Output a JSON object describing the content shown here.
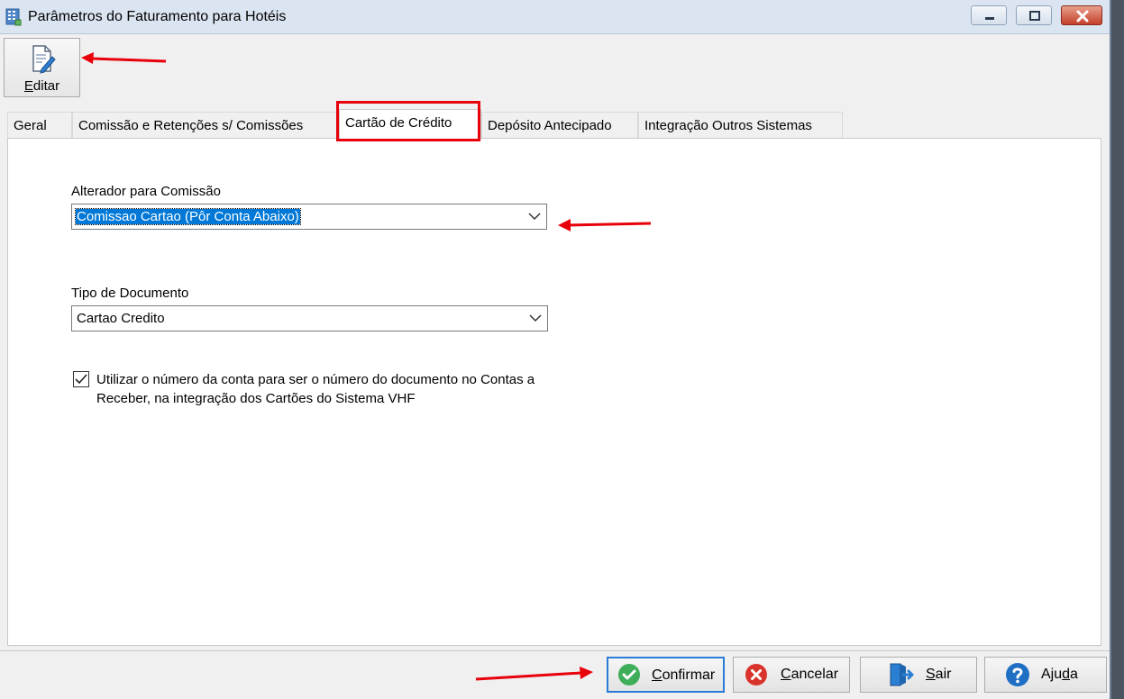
{
  "window": {
    "title": "Parâmetros do Faturamento para Hotéis"
  },
  "toolbar": {
    "edit_label": "Editar",
    "edit_accel": "E",
    "edit_rest": "ditar"
  },
  "tabs": [
    {
      "label": "Geral"
    },
    {
      "label": "Comissão e Retenções s/ Comissões"
    },
    {
      "label": "Cartão de Crédito",
      "active": true
    },
    {
      "label": "Depósito Antecipado"
    },
    {
      "label": "Integração Outros Sistemas"
    }
  ],
  "form": {
    "alterador_label": "Alterador para Comissão",
    "alterador_value": "Comissao Cartao (Pôr Conta Abaixo)",
    "tipo_label": "Tipo de Documento",
    "tipo_value": "Cartao Credito",
    "checkbox_checked": true,
    "checkbox_text": "Utilizar o número da conta para ser o número do documento no Contas a Receber, na integração dos Cartões do Sistema VHF"
  },
  "buttons": {
    "confirm": {
      "accel": "C",
      "rest": "onfirmar"
    },
    "cancel": {
      "accel": "C",
      "rest": "ancelar"
    },
    "exit": {
      "accel": "S",
      "rest": "air"
    },
    "help": {
      "pre": "Aju",
      "accel": "d",
      "rest": "a"
    }
  },
  "colors": {
    "annotation_red": "#e8000b",
    "selection_blue": "#0078d7",
    "confirm_green": "#3fae5a",
    "cancel_red": "#d9342b",
    "help_blue": "#1f6fc5",
    "exit_blue": "#2b7fd3"
  },
  "icons": {
    "app": "app-grid-icon",
    "edit": "edit-document-icon",
    "confirm": "check-circle-icon",
    "cancel": "x-circle-icon",
    "exit": "exit-door-icon",
    "help": "question-circle-icon",
    "dropdown": "chevron-down-icon"
  }
}
